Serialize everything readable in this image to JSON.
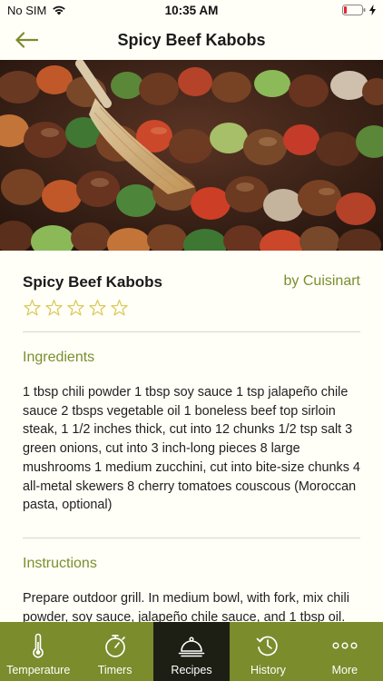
{
  "status_bar": {
    "carrier": "No SIM",
    "time": "10:35 AM"
  },
  "nav": {
    "title": "Spicy Beef Kabobs",
    "back_icon": "back-arrow-icon"
  },
  "recipe": {
    "title": "Spicy Beef Kabobs",
    "author": "by Cuisinart",
    "rating": 0,
    "rating_max": 5,
    "ingredients_heading": "Ingredients",
    "ingredients_text": "1 tbsp chili powder 1 tbsp soy sauce 1 tsp jalapeño chile sauce 2 tbsps vegetable oil 1 boneless beef top sirloin steak, 1 1/2 inches thick, cut into 12 chunks 1/2 tsp salt 3 green onions, cut into 3 inch-long pieces 8 large mushrooms 1 medium zucchini, cut into bite-size chunks 4 all-metal skewers 8 cherry tomatoes couscous (Moroccan pasta, optional)",
    "instructions_heading": "Instructions",
    "instructions_text": "Prepare outdoor grill. In medium bowl, with fork, mix chili powder, soy sauce, jalapeño chile sauce, and 1 tbsp oil."
  },
  "tabs": [
    {
      "label": "Temperature",
      "icon": "thermometer-icon"
    },
    {
      "label": "Timers",
      "icon": "stopwatch-icon"
    },
    {
      "label": "Recipes",
      "icon": "cloche-icon",
      "active": true
    },
    {
      "label": "History",
      "icon": "history-icon"
    },
    {
      "label": "More",
      "icon": "more-dots-icon"
    }
  ],
  "colors": {
    "accent": "#7a8c2c",
    "accent_text": "#7a8f2e",
    "active_tab": "#1e1f14",
    "background": "#fffef7"
  }
}
